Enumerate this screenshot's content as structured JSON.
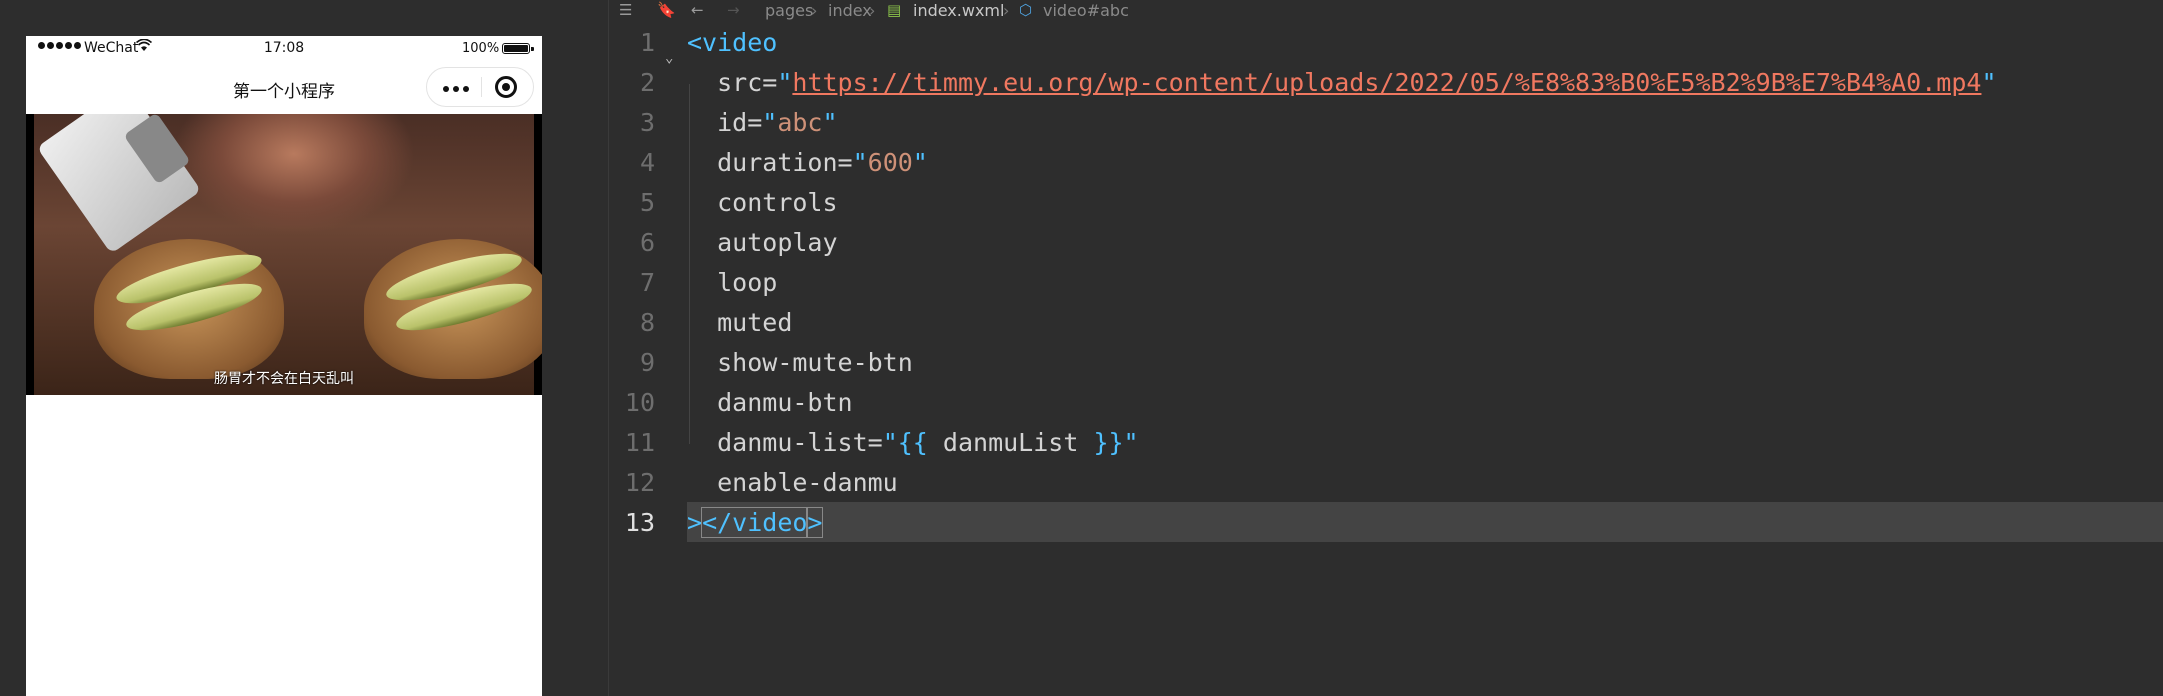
{
  "simulator": {
    "status_bar": {
      "carrier": "WeChat",
      "time": "17:08",
      "battery": "100%"
    },
    "nav_title": "第一个小程序",
    "video_subtitle": "肠胃才不会在白天乱叫"
  },
  "editor": {
    "breadcrumb": [
      "pages",
      "index",
      "index.wxml",
      "video#abc"
    ],
    "lines": [
      {
        "n": "1"
      },
      {
        "n": "2"
      },
      {
        "n": "3"
      },
      {
        "n": "4"
      },
      {
        "n": "5"
      },
      {
        "n": "6"
      },
      {
        "n": "7"
      },
      {
        "n": "8"
      },
      {
        "n": "9"
      },
      {
        "n": "10"
      },
      {
        "n": "11"
      },
      {
        "n": "12"
      },
      {
        "n": "13"
      }
    ],
    "code": {
      "open_tag": "<video",
      "src_attr": "src=",
      "src_value": "https://timmy.eu.org/wp-content/uploads/2022/05/%E8%83%B0%E5%B2%9B%E7%B4%A0.mp4",
      "id_attr": "id=",
      "id_value": "abc",
      "duration_attr": "duration=",
      "duration_value": "600",
      "l5": "controls",
      "l6": "autoplay",
      "l7": "loop",
      "l8": "muted",
      "l9": "show-mute-btn",
      "l10": "danmu-btn",
      "danmu_list_attr": "danmu-list=",
      "danmu_list_value": " danmuList ",
      "l12": "enable-danmu",
      "close_gt": ">",
      "close_tag": "</video",
      "close_end": ">"
    }
  },
  "colors": {
    "tag": "#4fc1ff",
    "string": "#ce9178",
    "url": "#f07860",
    "editor_bg": "#2d2d2d"
  }
}
